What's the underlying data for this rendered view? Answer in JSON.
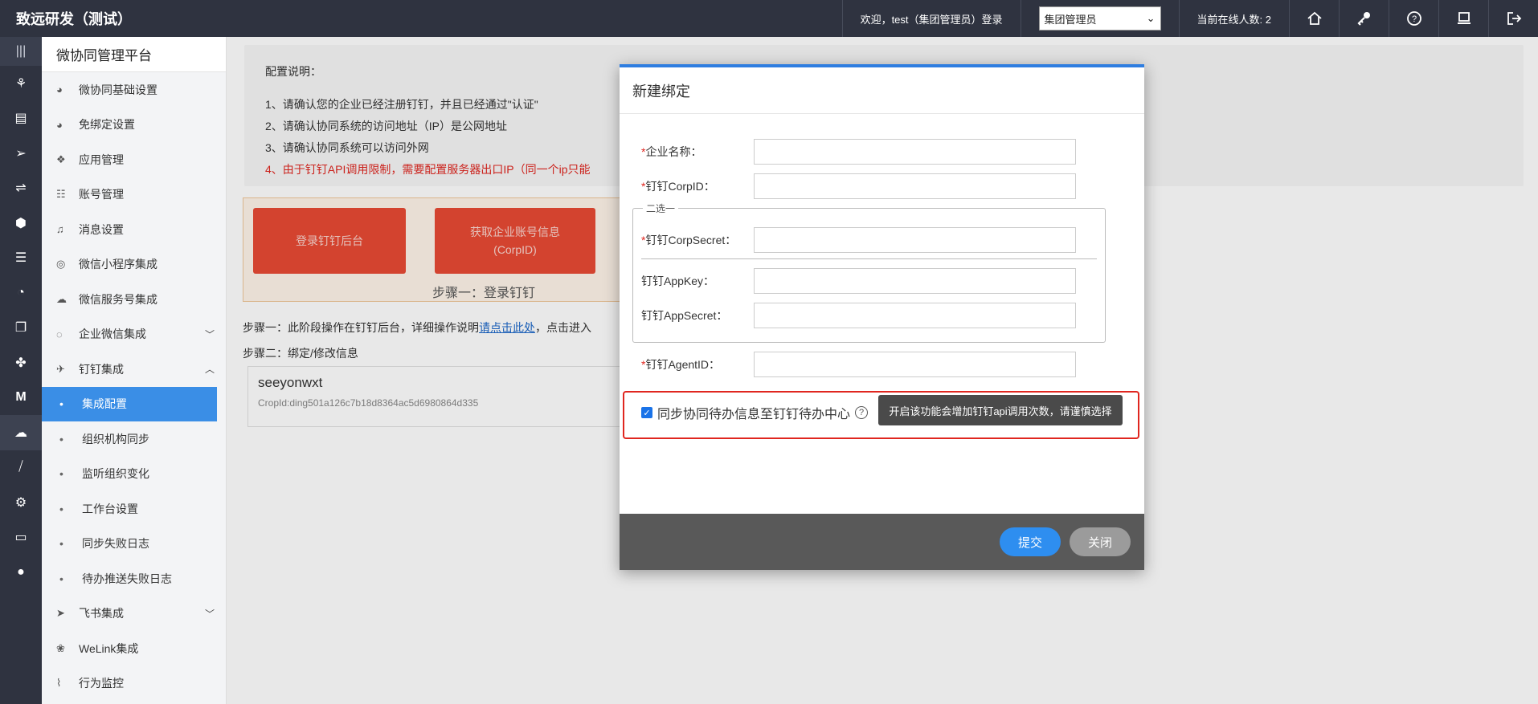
{
  "topbar": {
    "brand": "致远研发（测试）",
    "welcome": "欢迎，test（集团管理员）登录",
    "role_select": "集团管理员",
    "online": "当前在线人数: 2",
    "icons": [
      "home-icon",
      "key-icon",
      "help-icon",
      "screen-icon",
      "logout-icon"
    ]
  },
  "rail": {
    "items": [
      "menu-toggle-icon",
      "org-icon",
      "list-icon",
      "send-icon",
      "flow-icon",
      "box-icon",
      "server-icon",
      "speed-icon",
      "doc-icon",
      "apps-icon",
      "m-icon",
      "wechat-icon",
      "code-icon",
      "settings-icon",
      "monitor-icon",
      "user-icon"
    ]
  },
  "menu": {
    "title": "微协同管理平台",
    "items": [
      {
        "label": "微协同基础设置"
      },
      {
        "label": "免绑定设置"
      },
      {
        "label": "应用管理"
      },
      {
        "label": "账号管理"
      },
      {
        "label": "消息设置"
      },
      {
        "label": "微信小程序集成"
      },
      {
        "label": "微信服务号集成"
      },
      {
        "label": "企业微信集成"
      },
      {
        "label": "钉钉集成"
      },
      {
        "label": "集成配置"
      },
      {
        "label": "组织机构同步"
      },
      {
        "label": "监听组织变化"
      },
      {
        "label": "工作台设置"
      },
      {
        "label": "同步失败日志"
      },
      {
        "label": "待办推送失败日志"
      },
      {
        "label": "飞书集成"
      },
      {
        "label": "WeLink集成"
      },
      {
        "label": "行为监控"
      }
    ]
  },
  "notice": {
    "title": "配置说明：",
    "lines": [
      "1、请确认您的企业已经注册钉钉，并且已经通过\"认证\"",
      "2、请确认协同系统的访问地址（IP）是公网地址",
      "3、请确认协同系统可以访问外网",
      "4、由于钉钉API调用限制，需要配置服务器出口IP（同一个ip只能"
    ]
  },
  "steps": {
    "step1_btn": "登录钉钉后台",
    "step2_btn_line1": "获取企业账号信息",
    "step2_btn_line2": "(CorpID)",
    "caption": "步骤一：登录钉钉",
    "line1_prefix": "步骤一：此阶段操作在钉钉后台，详细操作说明",
    "line1_link": "请点击此处",
    "line1_suffix": "，点击进入",
    "line2": "步骤二：绑定/修改信息"
  },
  "binding": {
    "name": "seeyonwxt",
    "corpid": "CropId:ding501a126c7b18d8364ac5d6980864d335"
  },
  "modal": {
    "title": "新建绑定",
    "req_mark": "*",
    "fields": {
      "corp_name": "企业名称：",
      "corp_id": "钉钉CorpID：",
      "corp_secret": "钉钉CorpSecret：",
      "app_key": "钉钉AppKey：",
      "app_secret": "钉钉AppSecret：",
      "agent_id": "钉钉AgentID："
    },
    "choose_one": "二选一",
    "sync_label": "同步协同待办信息至钉钉待办中心",
    "sync_checked": true,
    "tooltip": "开启该功能会增加钉钉api调用次数，请谨慎选择",
    "submit": "提交",
    "close": "关闭"
  }
}
